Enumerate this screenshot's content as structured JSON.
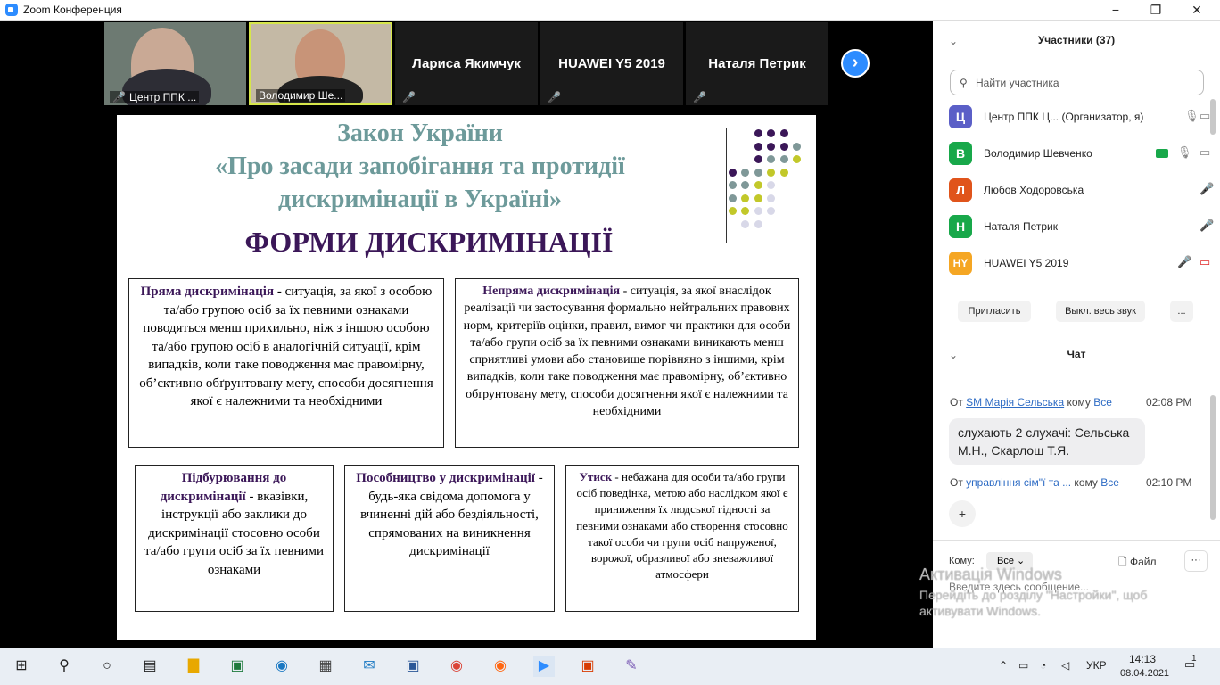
{
  "window": {
    "title": "Zoom Конференция",
    "min": "−",
    "max": "❐",
    "close": "✕"
  },
  "gallery": {
    "tiles": [
      {
        "caption": "Центр ППК ..."
      },
      {
        "caption": "Володимир Ше..."
      },
      {
        "name": "Лариса Якимчук"
      },
      {
        "name": "HUAWEI Y5 2019"
      },
      {
        "name": "Наталя Петрик"
      }
    ],
    "next": "›",
    "mic_muted": "🎤̸"
  },
  "slide": {
    "title1": "Закон України",
    "title2": "«Про засади запобігання та протидії",
    "title3": "дискримінації в Україні»",
    "subtitle": "ФОРМИ ДИСКРИМІНАЦІЇ",
    "boxes": [
      {
        "term": "Пряма дискримінація",
        "text": " - ситуація, за якої з особою та/або групою осіб за їх певними ознаками поводяться менш прихильно, ніж з іншою особою та/або групою осіб в аналогічній ситуації, крім випадків, коли таке поводження має правомірну, об’єктивно обґрунтовану мету, способи досягнення якої є належними та необхідними"
      },
      {
        "term": "Непряма дискримінація",
        "text": " - ситуація, за якої внаслідок реалізації чи застосування формально нейтральних правових норм, критеріїв оцінки, правил, вимог чи практики для особи та/або групи осіб за їх певними ознаками виникають менш сприятливі умови або становище порівняно з іншими, крім випадків, коли таке поводження має правомірну, об’єктивно обґрунтовану мету, способи досягнення якої є належними та необхідними"
      },
      {
        "term": "Підбурювання до дискримінації",
        "text": " - вказівки, інструкції або заклики до дискримінації стосовно особи та/або групи осіб за їх певними ознаками"
      },
      {
        "term": "Пособництво у дискримінації",
        "text": " - будь-яка свідома допомога у вчиненні дій або бездіяльності, спрямованих на виникнення дискримінації"
      },
      {
        "term": "Утиск",
        "text": " - небажана для особи та/або групи осіб поведінка, метою або наслідком якої є приниження їх людської гідності за певними ознаками або створення стосовно такої особи чи групи осіб напруженої, ворожої, образливої або зневажливої атмосфери"
      }
    ]
  },
  "participants": {
    "header": "Участники (37)",
    "search_placeholder": "Найти участника",
    "list": [
      {
        "initial": "Ц",
        "name": "Центр ППК Ц... (Организатор, я)",
        "color": "#5b5fc7"
      },
      {
        "initial": "В",
        "name": "Володимир Шевченко",
        "color": "#18a84a"
      },
      {
        "initial": "Л",
        "name": "Любов Ходоровська",
        "color": "#e0541b"
      },
      {
        "initial": "Н",
        "name": "Наталя Петрик",
        "color": "#18a84a"
      },
      {
        "initial": "HY",
        "name": "HUAWEI Y5 2019",
        "color": "#f5a623"
      }
    ],
    "invite": "Пригласить",
    "mute_all": "Выкл. весь звук",
    "more": "..."
  },
  "chat": {
    "header": "Чат",
    "messages": [
      {
        "from_prefix": "От ",
        "from": "SM Марія Сельська",
        "to_prefix": " кому ",
        "to": "Все",
        "time": "02:08 PM",
        "text": "слухають 2 слухачі: Сельська М.Н., Скарлош Т.Я."
      },
      {
        "from_prefix": "От ",
        "from": "управління сім\"ї та ...",
        "to_prefix": " кому ",
        "to": "Все",
        "time": "02:10 PM"
      }
    ],
    "plus": "+",
    "to_label": "Кому:",
    "to_value": "Все",
    "file": "Файл",
    "input_placeholder": "Введите здесь сообщение..."
  },
  "activation": {
    "title": "Активація Windows",
    "line1": "Перейдіть до розділу \"Настройки\", щоб",
    "line2": "активувати Windows."
  },
  "taskbar": {
    "lang": "УКР",
    "time": "14:13",
    "date": "08.04.2021",
    "notif": "1"
  }
}
